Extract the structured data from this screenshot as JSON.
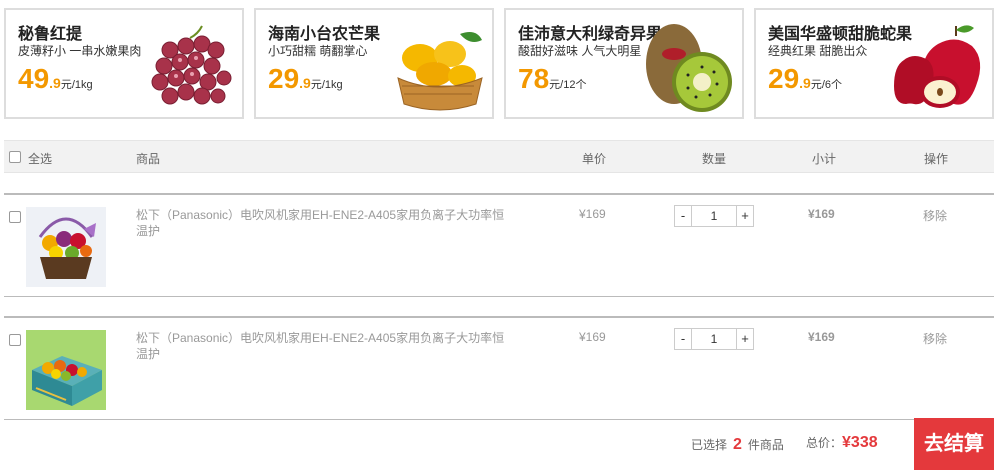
{
  "promos": [
    {
      "title": "秘鲁红提",
      "subtitle": "皮薄籽小 一串水嫩果肉",
      "price_int": "49",
      "price_frac": ".9",
      "unit": "元/1kg",
      "icon": "red-grapes-icon"
    },
    {
      "title": "海南小台农芒果",
      "subtitle": "小巧甜糯 萌翻掌心",
      "price_int": "29",
      "price_frac": ".9",
      "unit": "元/1kg",
      "icon": "mango-basket-icon"
    },
    {
      "title": "佳沛意大利绿奇异果",
      "subtitle": "酸甜好滋味 人气大明星",
      "price_int": "78",
      "price_frac": "",
      "unit": "元/12个",
      "icon": "kiwi-icon"
    },
    {
      "title": "美国华盛顿甜脆蛇果",
      "subtitle": "经典红果 甜脆出众",
      "price_int": "29",
      "price_frac": ".9",
      "unit": "元/6个",
      "icon": "red-apple-icon"
    }
  ],
  "table_header": {
    "select_all": "全选",
    "product": "商品",
    "unit_price": "单价",
    "quantity": "数量",
    "subtotal": "小计",
    "action": "操作"
  },
  "items": [
    {
      "name": "松下（Panasonic）电吹风机家用EH-ENE2-A405家用负离子大功率恒温护",
      "unit_price": "¥169",
      "qty": "1",
      "subtotal": "¥169",
      "remove": "移除",
      "minus": "-",
      "plus": "+",
      "thumb": "fruit-basket-image"
    },
    {
      "name": "松下（Panasonic）电吹风机家用EH-ENE2-A405家用负离子大功率恒温护",
      "unit_price": "¥169",
      "qty": "1",
      "subtotal": "¥169",
      "remove": "移除",
      "minus": "-",
      "plus": "+",
      "thumb": "fruit-gift-box-image"
    }
  ],
  "footer": {
    "selected_prefix": "已选择",
    "selected_count": "2",
    "selected_suffix": "件商品",
    "total_label": "总价：",
    "total_amount": "¥338",
    "checkout": "去结算"
  },
  "colors": {
    "accent_orange": "#f39800",
    "accent_red": "#e4393c"
  }
}
